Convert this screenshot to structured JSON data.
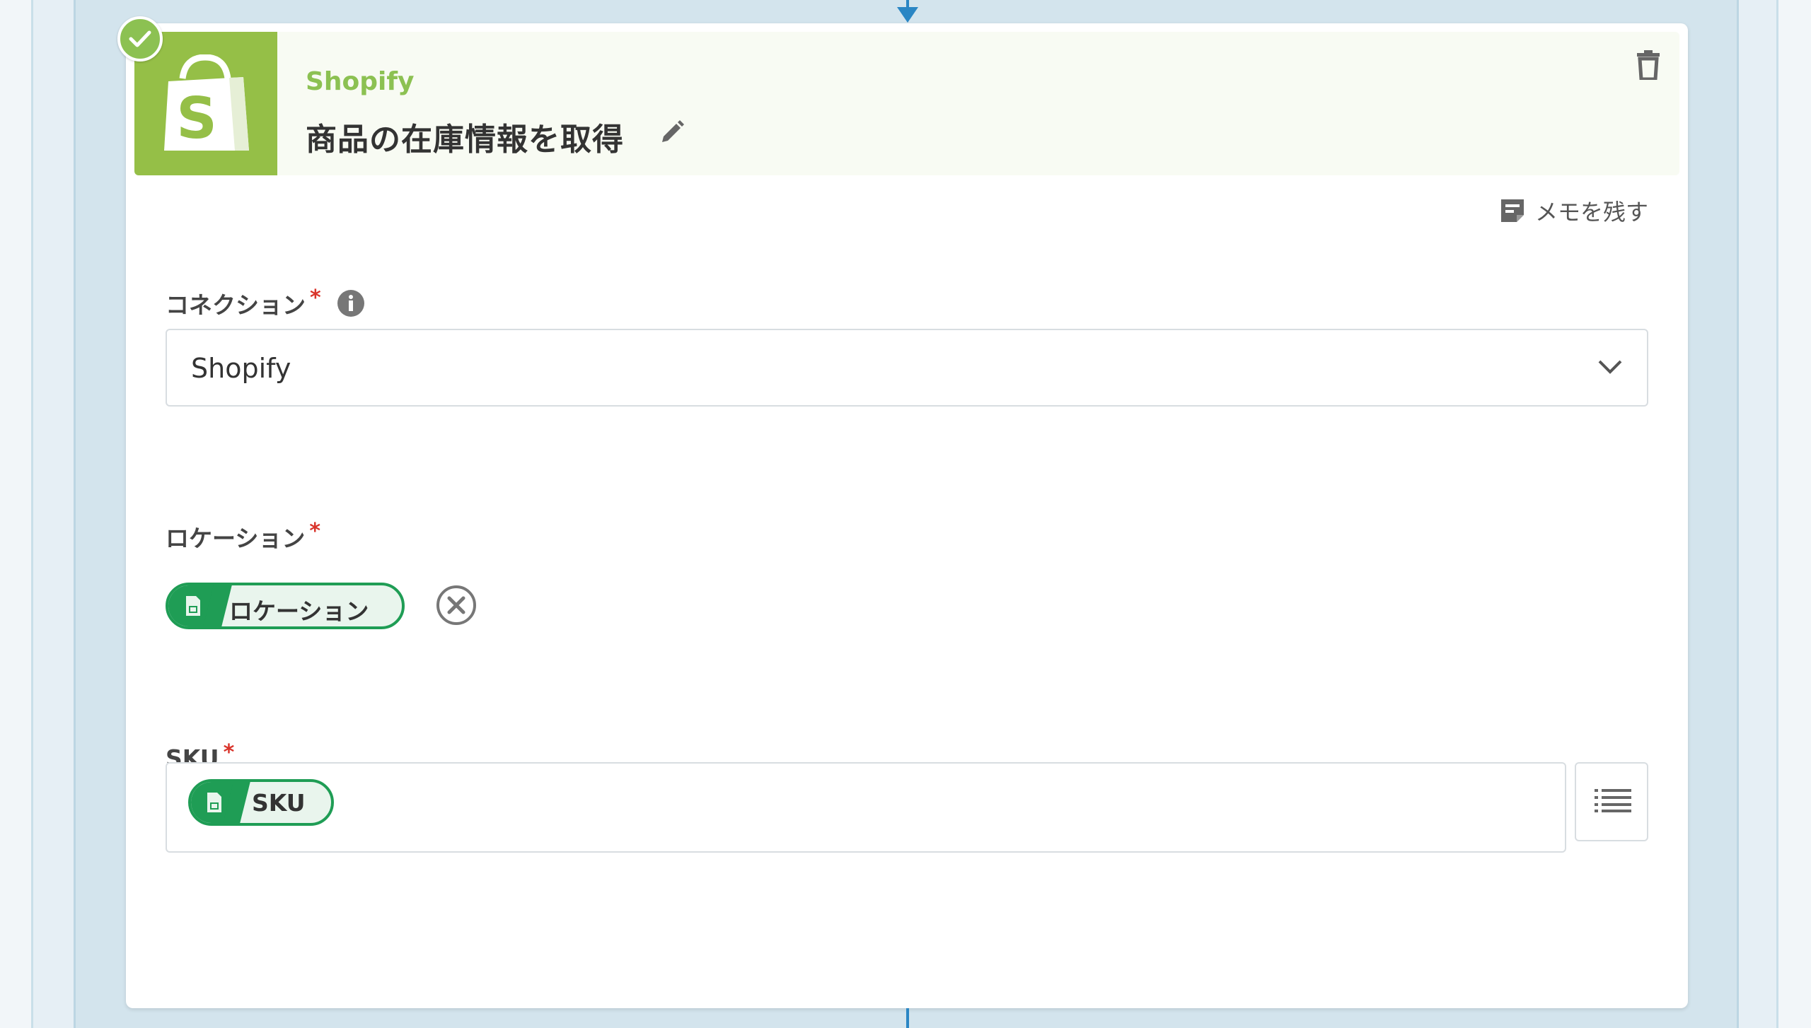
{
  "step": {
    "service_name": "Shopify",
    "title": "商品の在庫情報を取得",
    "status_icon": "check-icon",
    "delete_icon": "trash-icon",
    "edit_icon": "pencil-icon"
  },
  "memo": {
    "label": "メモを残す",
    "icon": "note-icon"
  },
  "connection": {
    "label": "コネクション",
    "required_mark": "*",
    "info_icon": "info-icon",
    "selected_value": "Shopify",
    "dropdown_icon": "chevron-down-icon"
  },
  "location": {
    "label": "ロケーション",
    "required_mark": "*",
    "chip_label": "ロケーション",
    "chip_icon": "spreadsheet-icon",
    "remove_icon": "close-circle-icon"
  },
  "sku": {
    "label": "SKU",
    "required_mark": "*",
    "chip_label": "SKU",
    "chip_icon": "spreadsheet-icon",
    "list_icon": "list-icon"
  },
  "colors": {
    "shopify_green": "#95bf47",
    "success_green": "#8cc152",
    "chip_green": "#1f9d55",
    "connector_blue": "#2a86c4",
    "required_red": "#d9342b"
  }
}
